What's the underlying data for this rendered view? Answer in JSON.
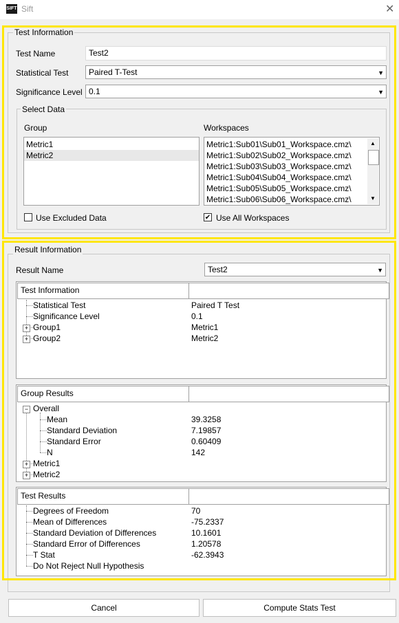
{
  "window": {
    "title": "Sift",
    "icon_text": "SIFT"
  },
  "test_info": {
    "legend": "Test Information",
    "test_name_label": "Test Name",
    "test_name_value": "Test2",
    "statistical_test_label": "Statistical Test",
    "statistical_test_value": "Paired T-Test",
    "significance_label": "Significance Level",
    "significance_value": "0.1",
    "select_data": {
      "legend": "Select Data",
      "group_label": "Group",
      "groups": [
        "Metric1",
        "Metric2"
      ],
      "workspaces_label": "Workspaces",
      "workspaces": [
        "Metric1:Sub01\\Sub01_Workspace.cmz\\",
        "Metric1:Sub02\\Sub02_Workspace.cmz\\",
        "Metric1:Sub03\\Sub03_Workspace.cmz\\",
        "Metric1:Sub04\\Sub04_Workspace.cmz\\",
        "Metric1:Sub05\\Sub05_Workspace.cmz\\",
        "Metric1:Sub06\\Sub06_Workspace.cmz\\"
      ],
      "use_excluded_label": "Use Excluded Data",
      "use_excluded_checked": false,
      "use_all_workspaces_label": "Use All Workspaces",
      "use_all_workspaces_checked": true
    }
  },
  "result_info": {
    "legend": "Result Information",
    "result_name_label": "Result Name",
    "result_name_value": "Test2",
    "panel1": {
      "header": "Test Information",
      "rows": [
        {
          "name": "Statistical Test",
          "value": "Paired T Test"
        },
        {
          "name": "Significance Level",
          "value": "0.1"
        },
        {
          "name": "Group1",
          "value": "Metric1"
        },
        {
          "name": "Group2",
          "value": "Metric2"
        }
      ]
    },
    "panel2": {
      "header": "Group Results",
      "overall": "Overall",
      "stats": [
        {
          "name": "Mean",
          "value": "39.3258"
        },
        {
          "name": "Standard Deviation",
          "value": "7.19857"
        },
        {
          "name": "Standard Error",
          "value": "0.60409"
        },
        {
          "name": "N",
          "value": "142"
        }
      ],
      "groups": [
        "Metric1",
        "Metric2"
      ]
    },
    "panel3": {
      "header": "Test Results",
      "rows": [
        {
          "name": "Degrees of Freedom",
          "value": "70"
        },
        {
          "name": "Mean of Differences",
          "value": "-75.2337"
        },
        {
          "name": "Standard Deviation of Differences",
          "value": "10.1601"
        },
        {
          "name": "Standard Error of Differences",
          "value": "1.20578"
        },
        {
          "name": "T Stat",
          "value": "-62.3943"
        },
        {
          "name": "Do Not Reject Null Hypothesis",
          "value": ""
        }
      ]
    }
  },
  "buttons": {
    "cancel": "Cancel",
    "compute": "Compute Stats Test"
  },
  "colors": {
    "highlight": "#ffe600",
    "background": "#f0f0f0"
  }
}
